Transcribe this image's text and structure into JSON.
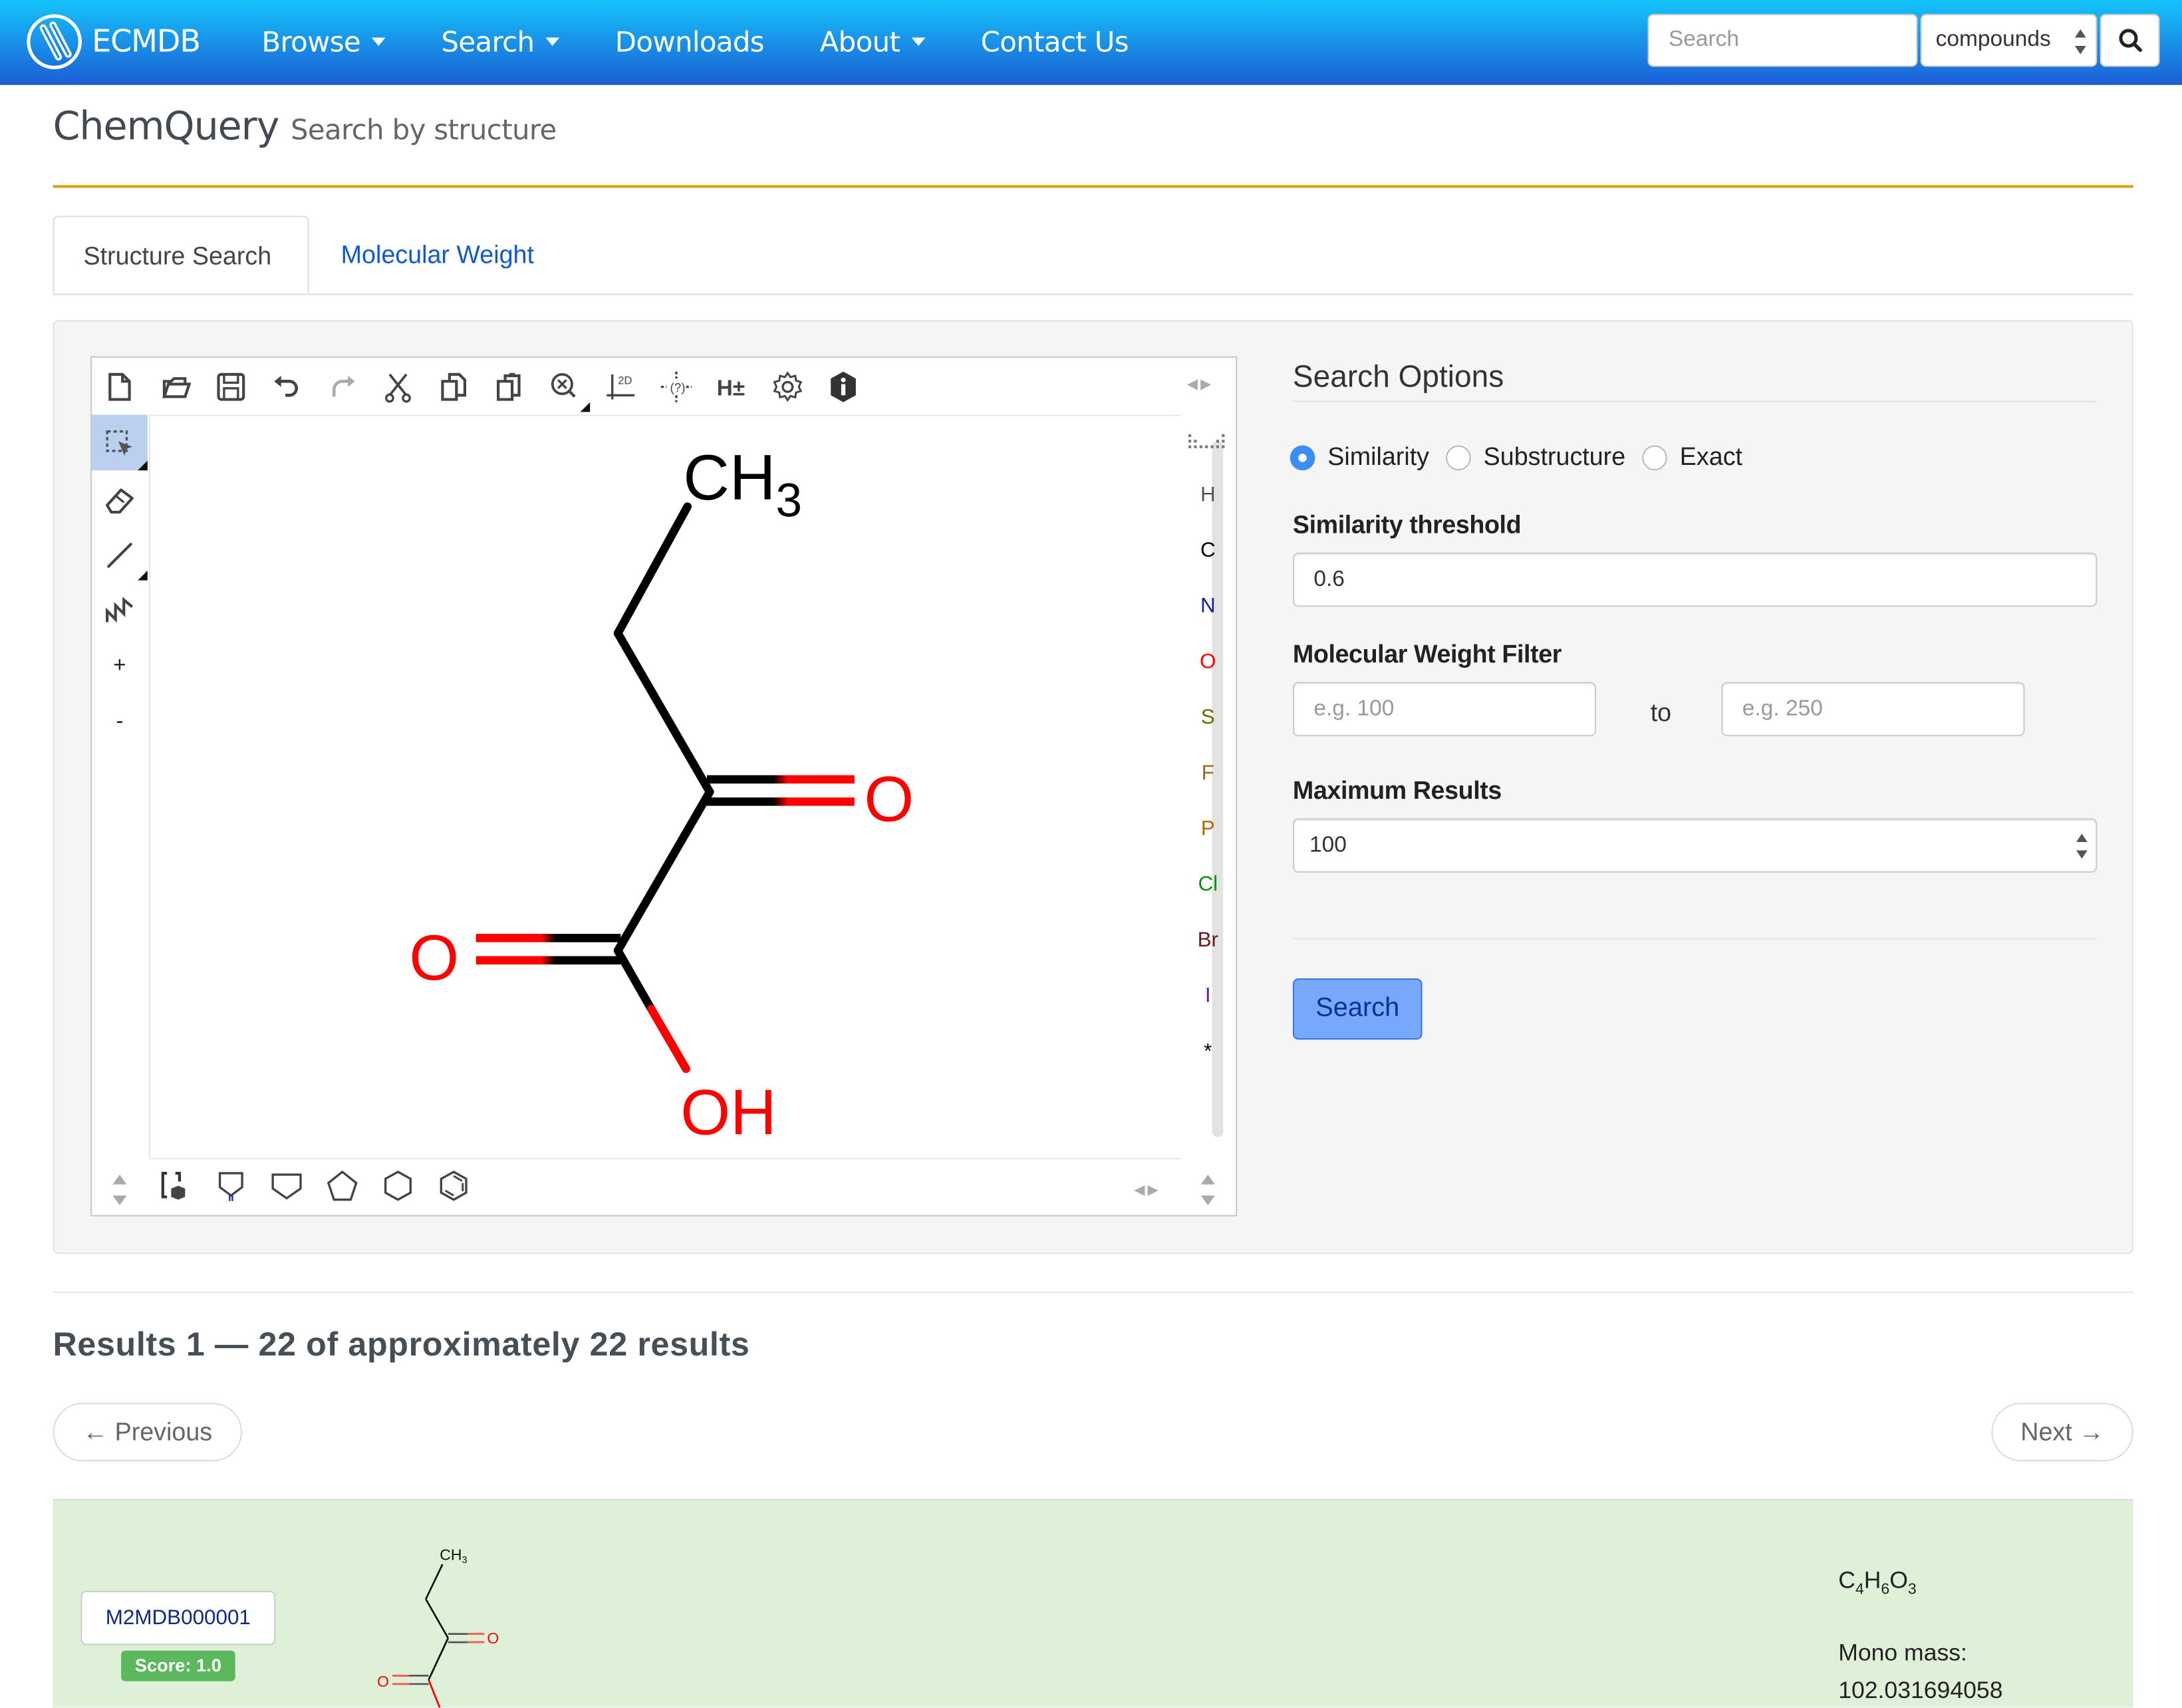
{
  "navbar": {
    "brand": "ECMDB",
    "items": [
      {
        "label": "Browse",
        "dropdown": true
      },
      {
        "label": "Search",
        "dropdown": true
      },
      {
        "label": "Downloads",
        "dropdown": false
      },
      {
        "label": "About",
        "dropdown": true
      },
      {
        "label": "Contact Us",
        "dropdown": false
      }
    ],
    "search_placeholder": "Search",
    "search_scope": "compounds",
    "colors": {
      "gradient_top": "#14c4fb",
      "gradient_bottom": "#1c60d6"
    }
  },
  "header": {
    "title": "ChemQuery",
    "subtitle": "Search by structure",
    "rule_color": "#dba21b"
  },
  "tabs": [
    {
      "label": "Structure Search",
      "active": true
    },
    {
      "label": "Molecular Weight",
      "active": false
    }
  ],
  "editor": {
    "top_toolbar": [
      "new-document",
      "open",
      "save",
      "undo",
      "redo",
      "cut",
      "copy",
      "paste",
      "zoom",
      "clean-2d",
      "query-atom",
      "toggle-hydrogens",
      "settings",
      "about"
    ],
    "left_toolbar": [
      "select",
      "erase",
      "bond",
      "chain",
      "+",
      "-"
    ],
    "atom_palette": [
      {
        "symbol": "H",
        "color": "#555555"
      },
      {
        "symbol": "C",
        "color": "#000000"
      },
      {
        "symbol": "N",
        "color": "#1a1aa0"
      },
      {
        "symbol": "O",
        "color": "#ff0000"
      },
      {
        "symbol": "S",
        "color": "#6b6b00"
      },
      {
        "symbol": "F",
        "color": "#a0641e"
      },
      {
        "symbol": "P",
        "color": "#b06a00"
      },
      {
        "symbol": "Cl",
        "color": "#109010"
      },
      {
        "symbol": "Br",
        "color": "#6b1a1a"
      },
      {
        "symbol": "I",
        "color": "#6a1aa0"
      },
      {
        "symbol": "*",
        "color": "#000000"
      }
    ],
    "bottom_toolbar": [
      "template-library",
      "fused-template",
      "cyclobutane",
      "cyclopentane",
      "cyclohexane",
      "benzene"
    ],
    "molecule_labels": {
      "methyl": "CH",
      "methyl_sub": "3",
      "ketone_o": "O",
      "acid_o": "O",
      "hydroxyl": "OH"
    }
  },
  "search_options": {
    "title": "Search Options",
    "modes": [
      {
        "label": "Similarity",
        "selected": true
      },
      {
        "label": "Substructure",
        "selected": false
      },
      {
        "label": "Exact",
        "selected": false
      }
    ],
    "threshold_label": "Similarity threshold",
    "threshold_value": "0.6",
    "mw_label": "Molecular Weight Filter",
    "mw_min_placeholder": "e.g. 100",
    "mw_to": "to",
    "mw_max_placeholder": "e.g. 250",
    "max_results_label": "Maximum Results",
    "max_results_value": "100",
    "search_button": "Search"
  },
  "results": {
    "summary": "Results 1 — 22 of approximately 22 results",
    "previous": "← Previous",
    "next": "Next →",
    "items": [
      {
        "id": "M2MDB000001",
        "score": "Score: 1.0",
        "formula": [
          {
            "el": "C",
            "n": "4"
          },
          {
            "el": "H",
            "n": "6"
          },
          {
            "el": "O",
            "n": "3"
          }
        ],
        "mono_mass_label": "Mono mass:",
        "mono_mass": "102.031694058",
        "structure_labels": {
          "methyl": "CH",
          "methyl_sub": "3",
          "o": "O"
        }
      }
    ]
  }
}
